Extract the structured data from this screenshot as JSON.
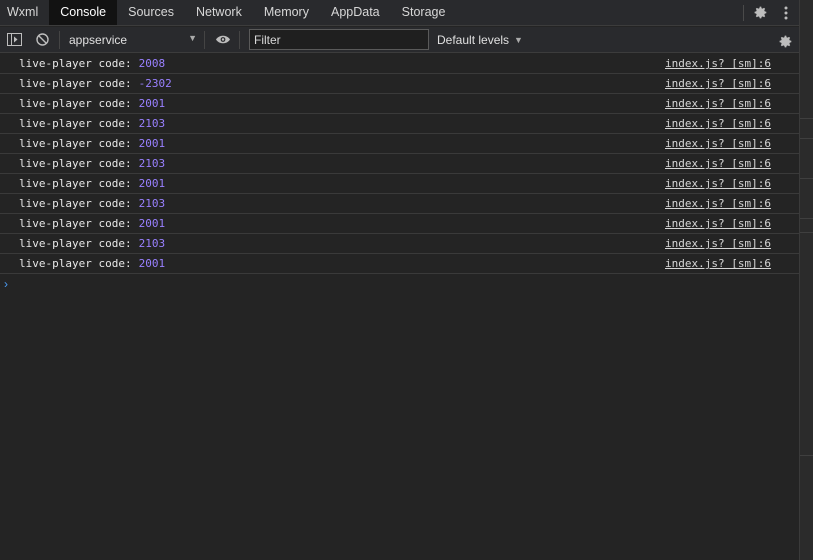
{
  "tabs": [
    {
      "label": "Wxml",
      "active": false
    },
    {
      "label": "Console",
      "active": true
    },
    {
      "label": "Sources",
      "active": false
    },
    {
      "label": "Network",
      "active": false
    },
    {
      "label": "Memory",
      "active": false
    },
    {
      "label": "AppData",
      "active": false
    },
    {
      "label": "Storage",
      "active": false
    }
  ],
  "toolbar": {
    "context": "appservice",
    "filter_placeholder": "Filter",
    "levels": "Default levels"
  },
  "logs": [
    {
      "message": "live-player code:",
      "code": "2008",
      "source": "index.js? [sm]:6"
    },
    {
      "message": "live-player code:",
      "code": "-2302",
      "source": "index.js? [sm]:6"
    },
    {
      "message": "live-player code:",
      "code": "2001",
      "source": "index.js? [sm]:6"
    },
    {
      "message": "live-player code:",
      "code": "2103",
      "source": "index.js? [sm]:6"
    },
    {
      "message": "live-player code:",
      "code": "2001",
      "source": "index.js? [sm]:6"
    },
    {
      "message": "live-player code:",
      "code": "2103",
      "source": "index.js? [sm]:6"
    },
    {
      "message": "live-player code:",
      "code": "2001",
      "source": "index.js? [sm]:6"
    },
    {
      "message": "live-player code:",
      "code": "2103",
      "source": "index.js? [sm]:6"
    },
    {
      "message": "live-player code:",
      "code": "2001",
      "source": "index.js? [sm]:6"
    },
    {
      "message": "live-player code:",
      "code": "2103",
      "source": "index.js? [sm]:6"
    },
    {
      "message": "live-player code:",
      "code": "2001",
      "source": "index.js? [sm]:6"
    }
  ],
  "prompt_symbol": "›",
  "colors": {
    "accent_number": "#9980ff",
    "prompt": "#4b9cf5",
    "active_tab_bg": "#121212"
  }
}
